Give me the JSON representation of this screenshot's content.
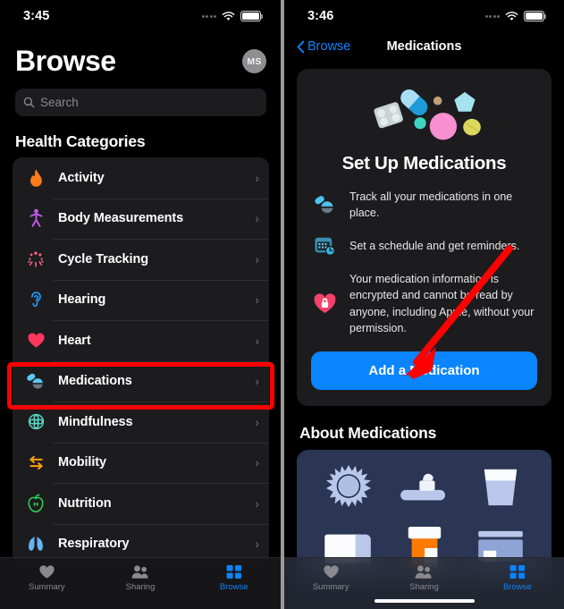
{
  "left": {
    "status": {
      "time": "3:45",
      "signal_icon": "signal-dots-icon",
      "wifi_icon": "wifi-icon",
      "battery_icon": "battery-icon"
    },
    "header": {
      "title": "Browse",
      "avatar_initials": "MS"
    },
    "search": {
      "placeholder": "Search",
      "icon": "search-icon"
    },
    "section_title": "Health Categories",
    "categories": [
      {
        "label": "Activity",
        "icon": "flame-icon",
        "color": "#ff7a1a"
      },
      {
        "label": "Body Measurements",
        "icon": "body-icon",
        "color": "#bf5af2"
      },
      {
        "label": "Cycle Tracking",
        "icon": "cycle-icon",
        "color": "#ff6482"
      },
      {
        "label": "Hearing",
        "icon": "ear-icon",
        "color": "#2196f3"
      },
      {
        "label": "Heart",
        "icon": "heart-icon",
        "color": "#ff375f"
      },
      {
        "label": "Medications",
        "icon": "pills-icon",
        "color": "#5ac8f5"
      },
      {
        "label": "Mindfulness",
        "icon": "brain-icon",
        "color": "#5adbc8"
      },
      {
        "label": "Mobility",
        "icon": "arrows-icon",
        "color": "#ff9f0a"
      },
      {
        "label": "Nutrition",
        "icon": "apple-icon",
        "color": "#30d158"
      },
      {
        "label": "Respiratory",
        "icon": "lungs-icon",
        "color": "#64b5f6"
      }
    ],
    "tabs": [
      {
        "label": "Summary",
        "icon": "heart-tab-icon",
        "active": false
      },
      {
        "label": "Sharing",
        "icon": "people-tab-icon",
        "active": false
      },
      {
        "label": "Browse",
        "icon": "grid-tab-icon",
        "active": true
      }
    ]
  },
  "right": {
    "status": {
      "time": "3:46",
      "signal_icon": "signal-dots-icon",
      "wifi_icon": "wifi-icon",
      "battery_icon": "battery-icon"
    },
    "nav": {
      "back_label": "Browse",
      "back_icon": "chevron-left-icon",
      "title": "Medications"
    },
    "hero": {
      "art_icon": "assorted-pills-illustration",
      "title": "Set Up Medications",
      "features": [
        {
          "icon": "pills-icon",
          "text": "Track all your medications in one place."
        },
        {
          "icon": "calendar-clock-icon",
          "text": "Set a schedule and get reminders."
        },
        {
          "icon": "heart-lock-icon",
          "text": "Your medication information is encrypted and cannot be read by anyone, including Apple, without your permission."
        }
      ],
      "cta_label": "Add a Medication"
    },
    "about": {
      "title": "About Medications",
      "art_icons": [
        "sun-icon",
        "toothbrush-icon",
        "water-glass-icon",
        "folded-towel-icon",
        "pill-bottle-icon",
        "medicine-box-icon"
      ]
    },
    "tabs": [
      {
        "label": "Summary",
        "icon": "heart-tab-icon",
        "active": false
      },
      {
        "label": "Sharing",
        "icon": "people-tab-icon",
        "active": false
      },
      {
        "label": "Browse",
        "icon": "grid-tab-icon",
        "active": true
      }
    ]
  },
  "annotations": {
    "highlight_box_color": "#ff0000",
    "arrow_color": "#ff0000",
    "arrow_target": "Add a Medication"
  },
  "colors": {
    "accent": "#0a84ff",
    "card": "#1c1c1e",
    "background": "#000000"
  }
}
